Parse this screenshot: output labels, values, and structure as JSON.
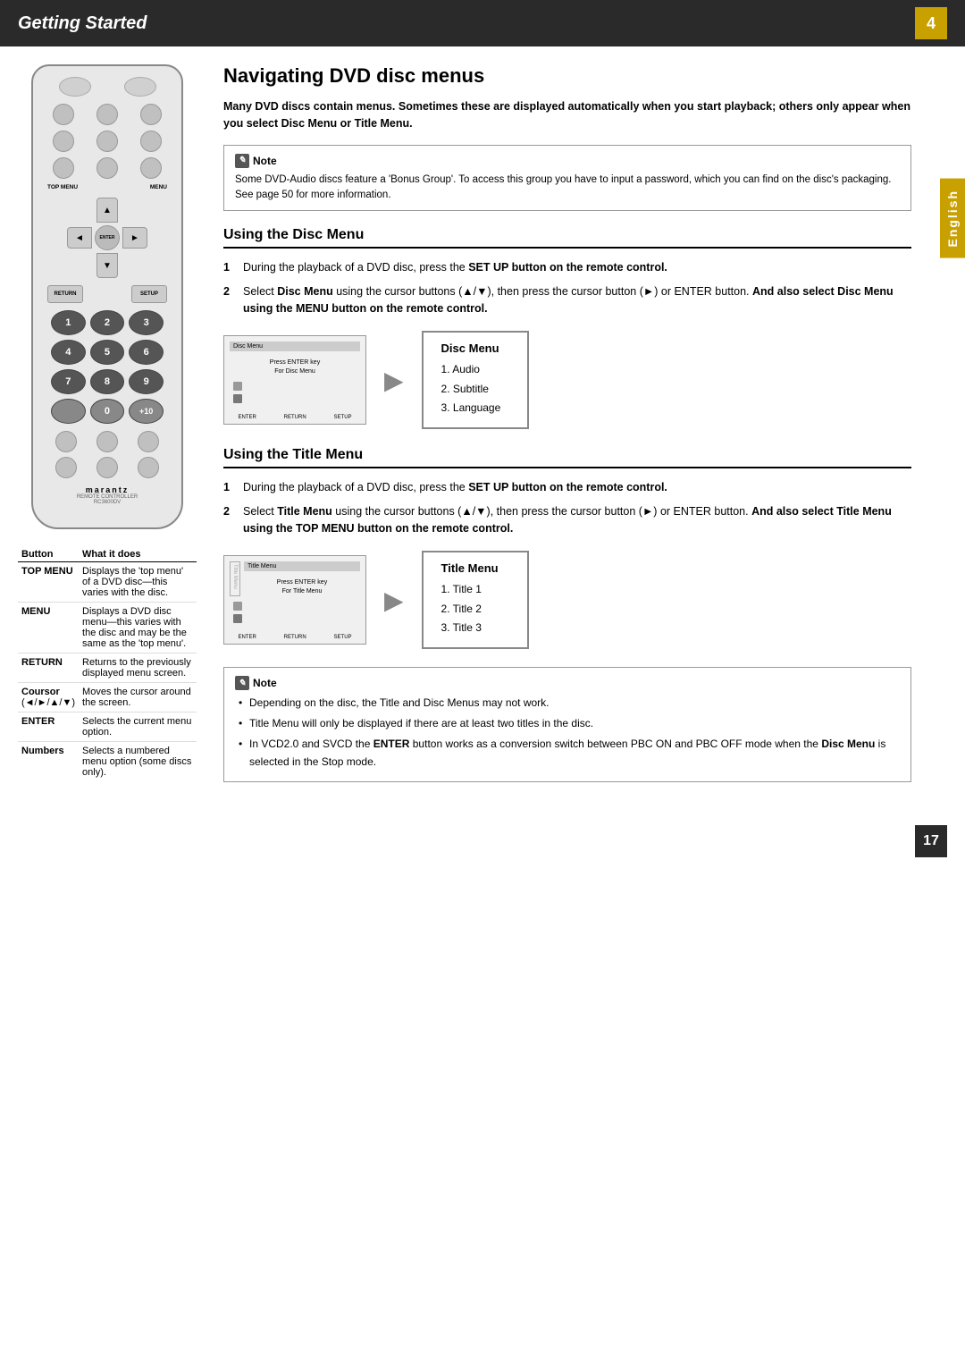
{
  "header": {
    "title": "Getting Started",
    "page_number": "4"
  },
  "english_tab": "English",
  "remote": {
    "brand": "marantz",
    "brand_sub1": "REMOTE CONTROLLER",
    "brand_sub2": "RC3600DV",
    "dpad": {
      "up": "▲",
      "down": "▼",
      "left": "◄",
      "right": "►",
      "center": "ENTER"
    },
    "top_labels": {
      "left": "TOP MENU",
      "right": "MENU"
    },
    "side_labels": {
      "left": "RETURN",
      "right": "SETUP"
    },
    "numbers": [
      "1",
      "2",
      "3",
      "4",
      "5",
      "6",
      "7",
      "8",
      "9",
      "",
      "0",
      "+10"
    ]
  },
  "button_table": {
    "headers": [
      "Button",
      "What it does"
    ],
    "rows": [
      {
        "button": "TOP MENU",
        "description": "Displays the 'top menu' of a DVD disc—this varies with the disc."
      },
      {
        "button": "MENU",
        "description": "Displays a DVD disc menu—this varies with the disc and may be the same as the 'top menu'."
      },
      {
        "button": "RETURN",
        "description": "Returns to the previously displayed menu screen."
      },
      {
        "button": "Coursor",
        "description": "Moves the cursor around the screen.",
        "extra": "(◄/►/▲/▼)"
      },
      {
        "button": "ENTER",
        "description": "Selects the current menu option."
      },
      {
        "button": "Numbers",
        "description": "Selects a numbered menu option (some discs only)."
      }
    ]
  },
  "main_section": {
    "title": "Navigating DVD disc menus",
    "intro": {
      "bold_text": "Many DVD discs contain menus. Sometimes these are displayed automatically when you start playback; others only appear when you select Disc Menu or Title Menu."
    },
    "note": {
      "title": "Note",
      "text": "Some DVD-Audio discs feature a 'Bonus Group'. To access this group you have to input a password, which you can find on the disc's packaging. See page 50 for more information."
    },
    "disc_menu_section": {
      "title": "Using the Disc Menu",
      "steps": [
        {
          "num": "1",
          "text": "During the playback of a DVD disc, press the SET UP button on the remote control."
        },
        {
          "num": "2",
          "text": "Select Disc Menu using the cursor buttons (▲/▼), then press the cursor button (►) or ENTER button. And also select Disc Menu using the MENU button on the remote control."
        }
      ],
      "screen_mockup": {
        "title_bar": "Disc Menu",
        "line1": "Press ENTER key",
        "line2": "For Disc Menu"
      },
      "result_menu": {
        "title": "Disc Menu",
        "items": [
          "1.  Audio",
          "2.  Subtitle",
          "3.  Language"
        ]
      }
    },
    "title_menu_section": {
      "title": "Using the Title Menu",
      "steps": [
        {
          "num": "1",
          "text": "During the playback of a DVD disc, press the SET UP button on the remote control."
        },
        {
          "num": "2",
          "text": "Select Title Menu using the cursor buttons (▲/▼), then press the cursor button (►) or ENTER button. And also select Title Menu using the TOP MENU button on the remote control."
        }
      ],
      "screen_mockup": {
        "title_bar": "Title Menu",
        "line1": "Press ENTER key",
        "line2": "For Title Menu"
      },
      "result_menu": {
        "title": "Title Menu",
        "items": [
          "1.  Title 1",
          "2.  Title 2",
          "3.  Title 3"
        ]
      }
    },
    "note2": {
      "items": [
        "Depending on the disc, the Title and Disc Menus may not work.",
        "Title Menu will only be displayed if there are at least two titles in the disc.",
        "In VCD2.0 and SVCD the ENTER button works as a conversion switch between PBC ON and PBC OFF mode when the Disc Menu is selected in the Stop mode."
      ]
    }
  },
  "footer": {
    "page_number": "17"
  }
}
